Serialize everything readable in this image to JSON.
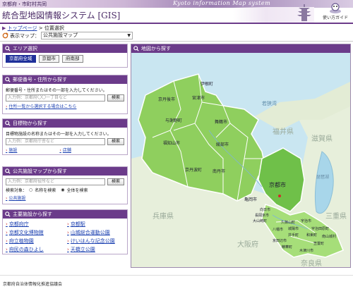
{
  "header": {
    "org": "京都府・市町村共同",
    "title": "統合型地図情報システム [GIS]",
    "en_title": "Kyoto information Map system",
    "guide_label": "使い方ガイド"
  },
  "breadcrumb": {
    "top": "トップページ",
    "sep": " > ",
    "current": "位置選択"
  },
  "map_select": {
    "label": "表示マップ：",
    "value": "公共施設マップ"
  },
  "area": {
    "title": "エリア選択",
    "tabs": [
      "京都府全域",
      "京都市",
      "府南部"
    ]
  },
  "address": {
    "title": "郵便番号・住所から探す",
    "desc": "郵便番号・住所またはその一部を入力してください。",
    "placeholder": "入力例：京都府〇〇一丁目など",
    "button": "検索",
    "link": "住所一覧から選択する場合はこちら"
  },
  "target": {
    "title": "目標物から探す",
    "desc": "目標物施設の名称またはその一部を入力してください。",
    "placeholder": "入力例：京都府庁舎など",
    "button": "検索",
    "links": [
      "施設",
      "店舗"
    ]
  },
  "facility": {
    "title": "公共施設マップから探す",
    "placeholder": "入力例：京都府役所など",
    "button": "検索",
    "target_label": "検索対象：",
    "radio1": "名称を検索",
    "radio2": "全体を検索",
    "link": "公共施設"
  },
  "major": {
    "title": "主要施設から探す",
    "items": [
      "京都府庁",
      "京都駅",
      "京都文化博物館",
      "山城総合運動公園",
      "府立植物園",
      "けいはんな記念公園",
      "府民の森ひよし",
      "天橋立公園"
    ]
  },
  "map": {
    "title": "地図から探す",
    "sea_label": "若狭湾",
    "prefs": [
      "福井県",
      "滋賀県",
      "兵庫県",
      "大阪府",
      "奈良県",
      "三重県"
    ],
    "lake": "琵琶湖",
    "cities": [
      "伊根町",
      "京丹後市",
      "宮津市",
      "与謝野町",
      "舞鶴市",
      "綾部市",
      "福知山市",
      "京丹波町",
      "南丹市",
      "京都市",
      "亀岡市",
      "向日市",
      "長岡京市",
      "大山崎町",
      "八幡市",
      "京田辺市",
      "精華町",
      "木津川市",
      "宇治市",
      "城陽市",
      "宇治田原町",
      "井手町",
      "和束町",
      "笠置町",
      "南山城村",
      "久御山町"
    ]
  },
  "footer": {
    "text": "京都府自治体情報化推進協議会"
  }
}
